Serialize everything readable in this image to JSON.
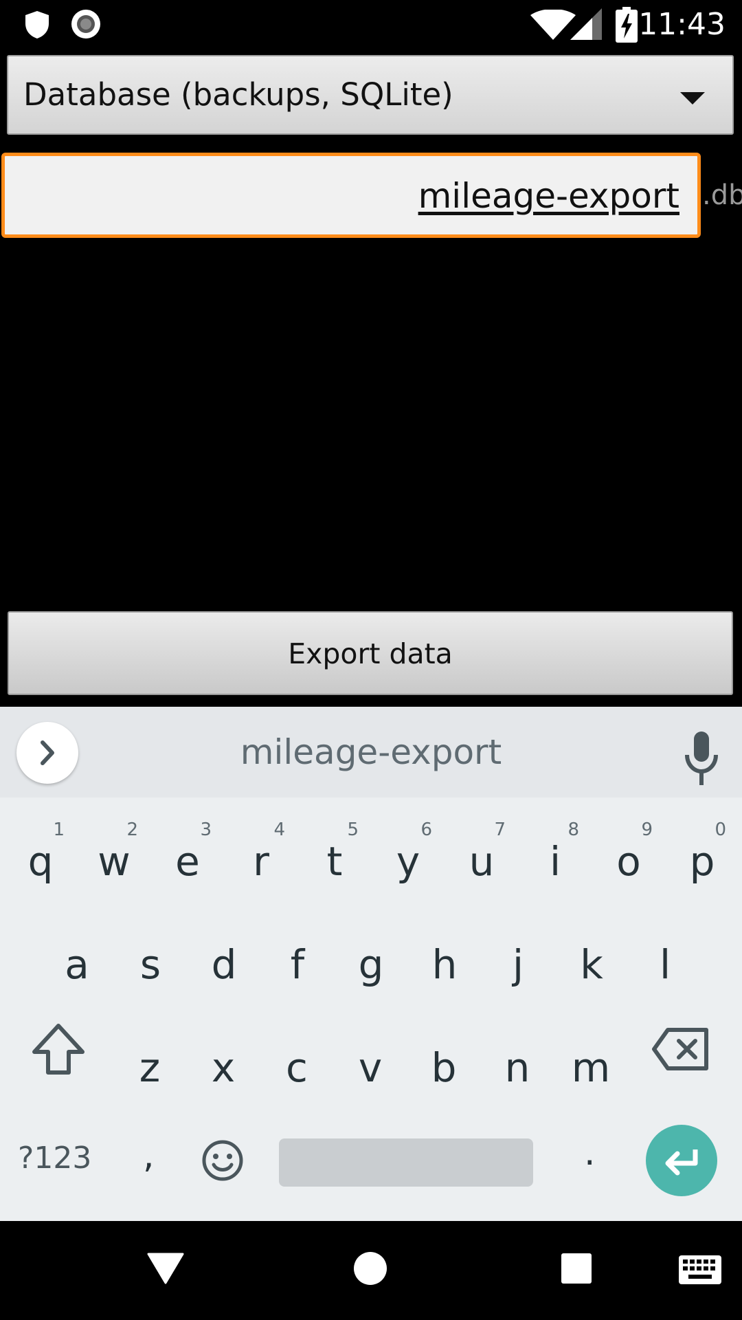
{
  "status_bar": {
    "time": "11:43",
    "icons": [
      "shield-icon",
      "record-icon",
      "wifi-icon",
      "cell-signal-icon",
      "battery-charging-icon"
    ]
  },
  "export_form": {
    "format_selected": "Database (backups, SQLite)",
    "filename_value": "mileage-export",
    "file_extension": ".db",
    "export_button_label": "Export data",
    "accent_color": "#ff8c1a"
  },
  "keyboard": {
    "suggestion": "mileage-export",
    "rows": [
      [
        {
          "letter": "q",
          "hint": "1"
        },
        {
          "letter": "w",
          "hint": "2"
        },
        {
          "letter": "e",
          "hint": "3"
        },
        {
          "letter": "r",
          "hint": "4"
        },
        {
          "letter": "t",
          "hint": "5"
        },
        {
          "letter": "y",
          "hint": "6"
        },
        {
          "letter": "u",
          "hint": "7"
        },
        {
          "letter": "i",
          "hint": "8"
        },
        {
          "letter": "o",
          "hint": "9"
        },
        {
          "letter": "p",
          "hint": "0"
        }
      ],
      [
        {
          "letter": "a"
        },
        {
          "letter": "s"
        },
        {
          "letter": "d"
        },
        {
          "letter": "f"
        },
        {
          "letter": "g"
        },
        {
          "letter": "h"
        },
        {
          "letter": "j"
        },
        {
          "letter": "k"
        },
        {
          "letter": "l"
        }
      ],
      [
        {
          "letter": "z"
        },
        {
          "letter": "x"
        },
        {
          "letter": "c"
        },
        {
          "letter": "v"
        },
        {
          "letter": "b"
        },
        {
          "letter": "n"
        },
        {
          "letter": "m"
        }
      ]
    ],
    "symbols_label": "?123",
    "comma_label": ",",
    "period_label": ".",
    "enter_color": "#4db6ac"
  },
  "nav_bar": {
    "buttons": [
      "back-icon",
      "home-icon",
      "recents-icon",
      "keyboard-switch-icon"
    ]
  }
}
